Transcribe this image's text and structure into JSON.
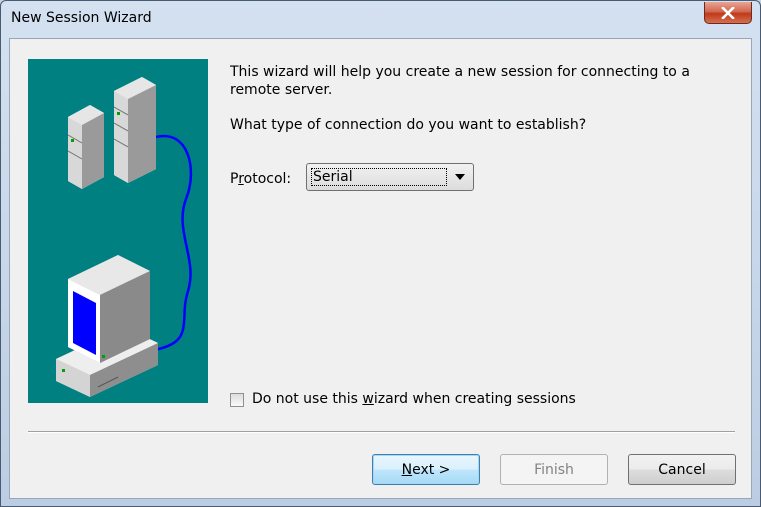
{
  "window": {
    "title": "New Session Wizard",
    "close_glyph": "×"
  },
  "wizard": {
    "intro": "This wizard will help you create a new session for connecting to a remote server.",
    "question": "What type of connection do you want to establish?",
    "protocol": {
      "label_pre": "P",
      "label_mnemonic": "r",
      "label_post": "otocol:",
      "selected": "Serial"
    },
    "checkbox": {
      "checked": false,
      "label_pre": "Do not use this ",
      "label_mnemonic": "w",
      "label_post": "izard when creating sessions"
    }
  },
  "buttons": {
    "next_mnemonic": "N",
    "next_rest": "ext >",
    "finish": "Finish",
    "cancel": "Cancel"
  },
  "illustration": {
    "background_color": "#008080",
    "icons": [
      "server-icon",
      "computer-icon",
      "cable-icon"
    ]
  }
}
